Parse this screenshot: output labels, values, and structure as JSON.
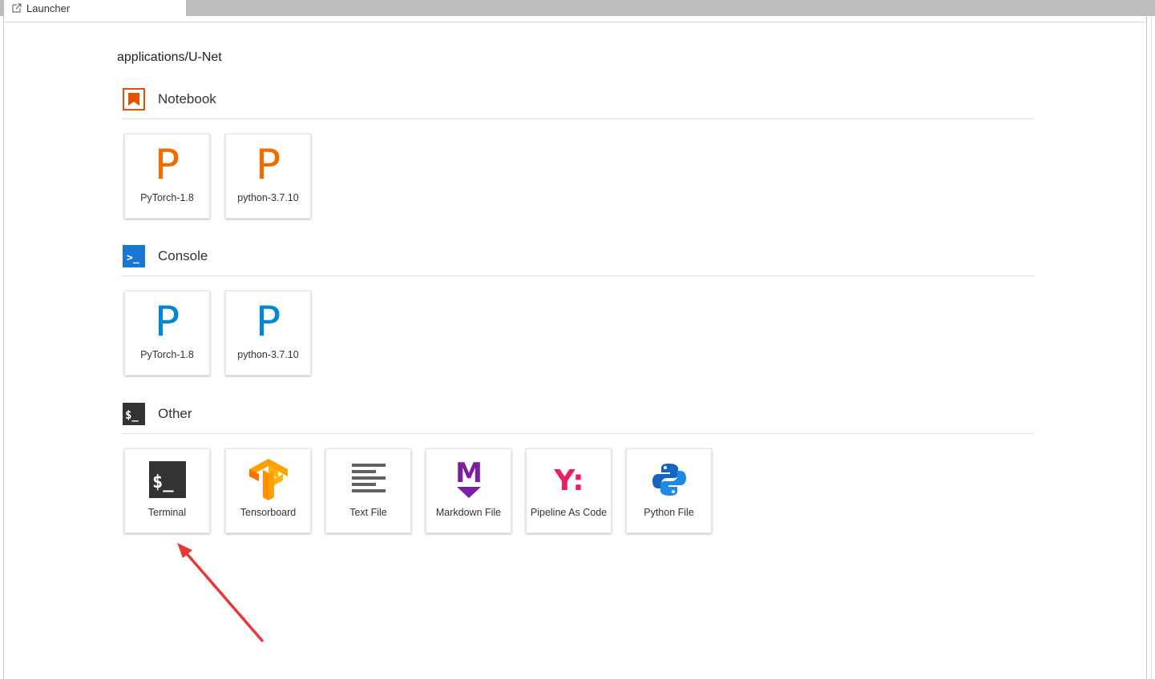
{
  "tab": {
    "title": "Launcher"
  },
  "cwd": "applications/U-Net",
  "sections": {
    "notebook": {
      "title": "Notebook",
      "cards": [
        {
          "letter": "P",
          "label": "PyTorch-1.8"
        },
        {
          "letter": "P",
          "label": "python-3.7.10"
        }
      ]
    },
    "console": {
      "title": "Console",
      "cards": [
        {
          "letter": "P",
          "label": "PyTorch-1.8"
        },
        {
          "letter": "P",
          "label": "python-3.7.10"
        }
      ]
    },
    "other": {
      "title": "Other",
      "cards": [
        {
          "label": "Terminal",
          "icon": "terminal-icon"
        },
        {
          "label": "Tensorboard",
          "icon": "tensorboard-icon"
        },
        {
          "label": "Text File",
          "icon": "text-file-icon"
        },
        {
          "label": "Markdown File",
          "icon": "markdown-icon"
        },
        {
          "label": "Pipeline As Code",
          "icon": "pipeline-as-code-icon"
        },
        {
          "label": "Python File",
          "icon": "python-icon"
        }
      ]
    }
  },
  "icon_text": {
    "console_prompt": ">_",
    "terminal_prompt": "$_",
    "markdown_letter": "M",
    "pipeline_letters": "Y:"
  },
  "colors": {
    "notebook_accent": "#E65100",
    "notebook_letter": "#EF6C00",
    "console_accent": "#1976D2",
    "console_letter": "#0288D1",
    "terminal_bg": "#333333",
    "markdown": "#7B1FA2",
    "pipeline": "#E91E63",
    "annotation_arrow": "#E53935"
  }
}
